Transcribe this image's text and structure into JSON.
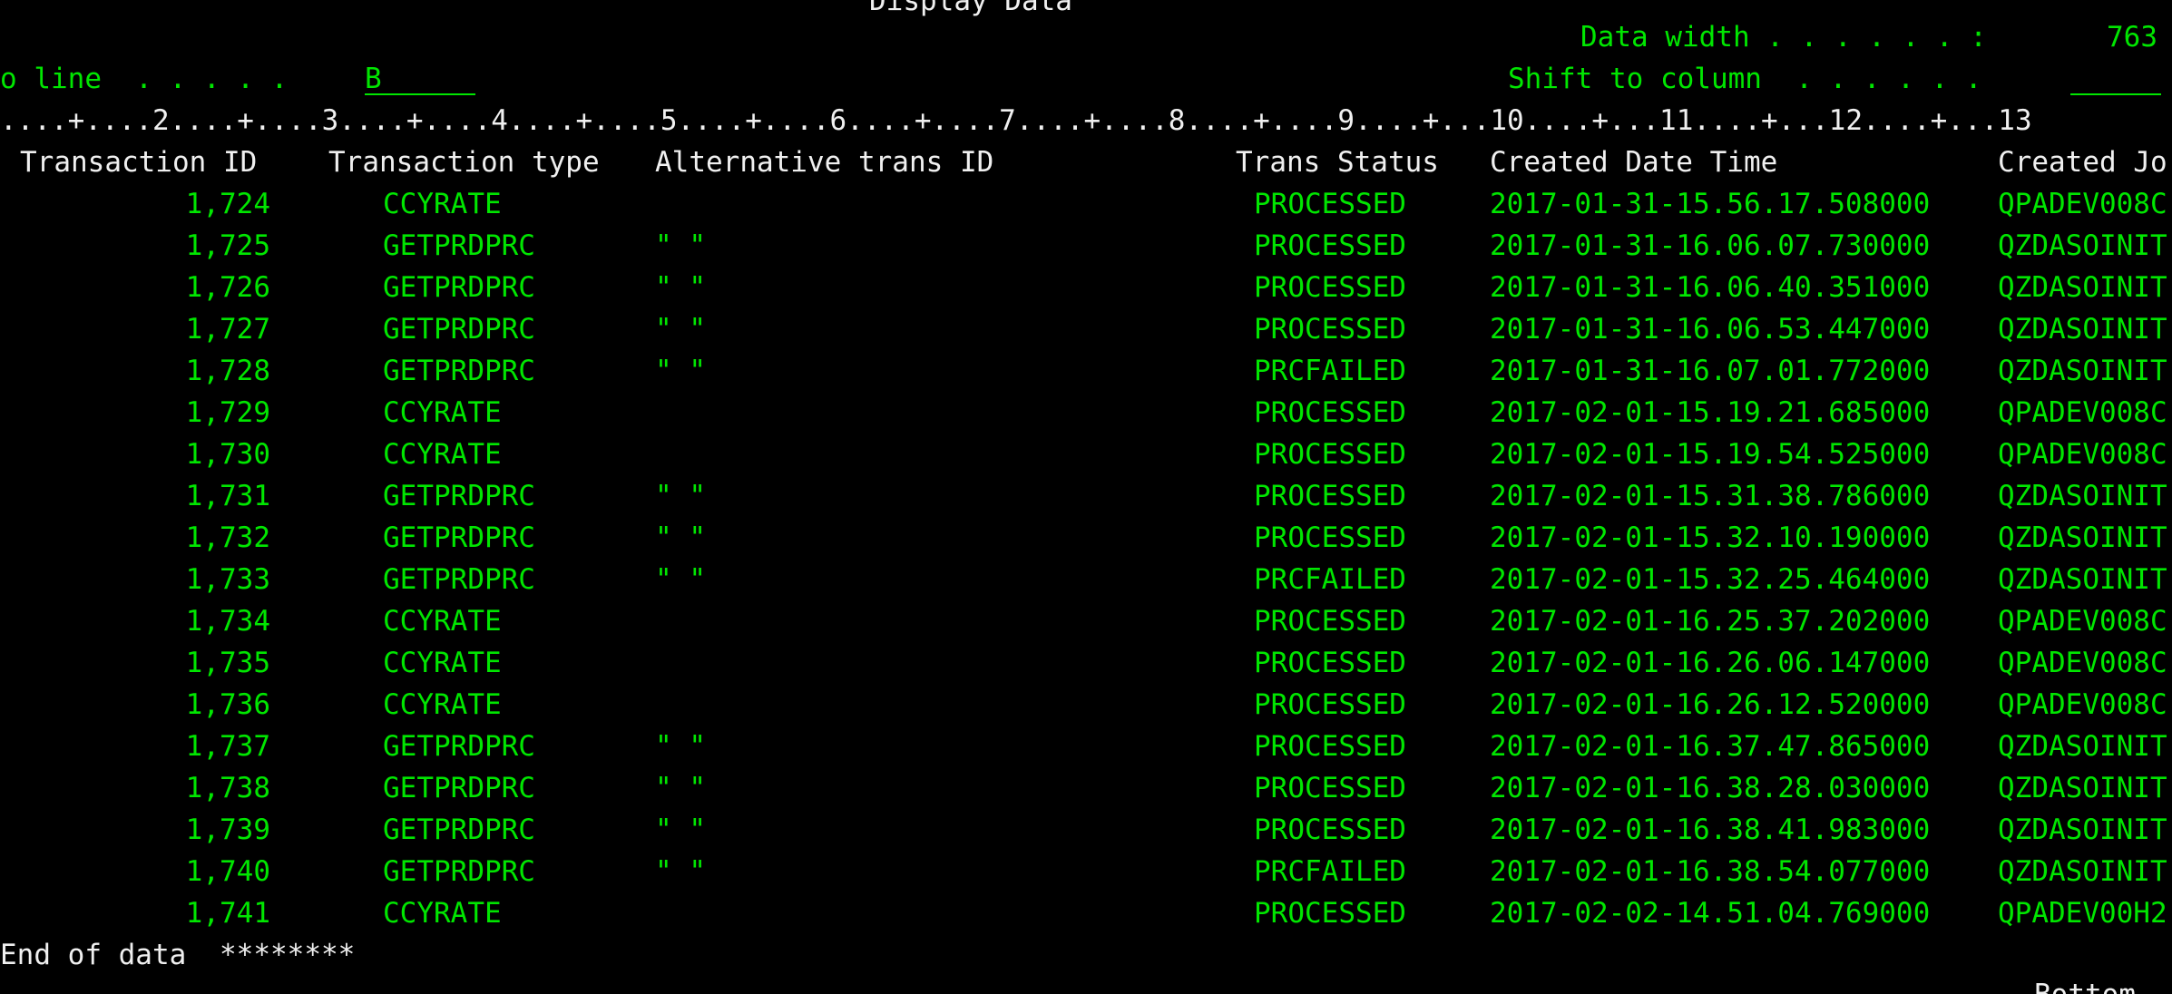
{
  "screen": {
    "title": "Display Data",
    "data_width_label": "Data width . . . . . . :",
    "data_width_value": "763",
    "position_label": "o line  . . . . .",
    "position_value": "B",
    "shift_label": "Shift to column  . . . . . .",
    "shift_value": "",
    "ruler": "....+....2....+....3....+....4....+....5....+....6....+....7....+....8....+....9....+...10....+...11....+...12....+...13",
    "end_message": "End of data",
    "end_stars": "********",
    "bottom_status": "Bottom"
  },
  "table": {
    "headers": {
      "transaction_id": "Transaction ID",
      "transaction_type": "Transaction type",
      "alternative_id": "Alternative trans ID",
      "status": "Trans Status",
      "created": "Created Date Time",
      "created_job": "Created Jo"
    },
    "rows": [
      {
        "id": "1,724",
        "type": "CCYRATE",
        "alt": "",
        "status": "PROCESSED",
        "created": "2017-01-31-15.56.17.508000",
        "job": "QPADEV008C"
      },
      {
        "id": "1,725",
        "type": "GETPRDPRC",
        "alt": "\" \"",
        "status": "PROCESSED",
        "created": "2017-01-31-16.06.07.730000",
        "job": "QZDASOINIT"
      },
      {
        "id": "1,726",
        "type": "GETPRDPRC",
        "alt": "\" \"",
        "status": "PROCESSED",
        "created": "2017-01-31-16.06.40.351000",
        "job": "QZDASOINIT"
      },
      {
        "id": "1,727",
        "type": "GETPRDPRC",
        "alt": "\" \"",
        "status": "PROCESSED",
        "created": "2017-01-31-16.06.53.447000",
        "job": "QZDASOINIT"
      },
      {
        "id": "1,728",
        "type": "GETPRDPRC",
        "alt": "\" \"",
        "status": "PRCFAILED",
        "created": "2017-01-31-16.07.01.772000",
        "job": "QZDASOINIT"
      },
      {
        "id": "1,729",
        "type": "CCYRATE",
        "alt": "",
        "status": "PROCESSED",
        "created": "2017-02-01-15.19.21.685000",
        "job": "QPADEV008C"
      },
      {
        "id": "1,730",
        "type": "CCYRATE",
        "alt": "",
        "status": "PROCESSED",
        "created": "2017-02-01-15.19.54.525000",
        "job": "QPADEV008C"
      },
      {
        "id": "1,731",
        "type": "GETPRDPRC",
        "alt": "\" \"",
        "status": "PROCESSED",
        "created": "2017-02-01-15.31.38.786000",
        "job": "QZDASOINIT"
      },
      {
        "id": "1,732",
        "type": "GETPRDPRC",
        "alt": "\" \"",
        "status": "PROCESSED",
        "created": "2017-02-01-15.32.10.190000",
        "job": "QZDASOINIT"
      },
      {
        "id": "1,733",
        "type": "GETPRDPRC",
        "alt": "\" \"",
        "status": "PRCFAILED",
        "created": "2017-02-01-15.32.25.464000",
        "job": "QZDASOINIT"
      },
      {
        "id": "1,734",
        "type": "CCYRATE",
        "alt": "",
        "status": "PROCESSED",
        "created": "2017-02-01-16.25.37.202000",
        "job": "QPADEV008C"
      },
      {
        "id": "1,735",
        "type": "CCYRATE",
        "alt": "",
        "status": "PROCESSED",
        "created": "2017-02-01-16.26.06.147000",
        "job": "QPADEV008C"
      },
      {
        "id": "1,736",
        "type": "CCYRATE",
        "alt": "",
        "status": "PROCESSED",
        "created": "2017-02-01-16.26.12.520000",
        "job": "QPADEV008C"
      },
      {
        "id": "1,737",
        "type": "GETPRDPRC",
        "alt": "\" \"",
        "status": "PROCESSED",
        "created": "2017-02-01-16.37.47.865000",
        "job": "QZDASOINIT"
      },
      {
        "id": "1,738",
        "type": "GETPRDPRC",
        "alt": "\" \"",
        "status": "PROCESSED",
        "created": "2017-02-01-16.38.28.030000",
        "job": "QZDASOINIT"
      },
      {
        "id": "1,739",
        "type": "GETPRDPRC",
        "alt": "\" \"",
        "status": "PROCESSED",
        "created": "2017-02-01-16.38.41.983000",
        "job": "QZDASOINIT"
      },
      {
        "id": "1,740",
        "type": "GETPRDPRC",
        "alt": "\" \"",
        "status": "PRCFAILED",
        "created": "2017-02-01-16.38.54.077000",
        "job": "QZDASOINIT"
      },
      {
        "id": "1,741",
        "type": "CCYRATE",
        "alt": "",
        "status": "PROCESSED",
        "created": "2017-02-02-14.51.04.769000",
        "job": "QPADEV00H2"
      }
    ]
  },
  "colors": {
    "background": "#000000",
    "field_text": "#00e600",
    "label_text": "#f0f0f0"
  }
}
